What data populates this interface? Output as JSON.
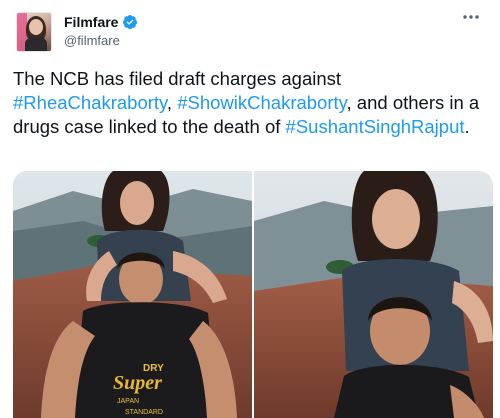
{
  "author": {
    "name": "Filmfare",
    "handle": "@filmfare",
    "verified": true,
    "avatar_icon": "filmfare-avatar"
  },
  "menu_icon": "more-dots-icon",
  "tweet": {
    "text_parts": [
      {
        "type": "text",
        "value": "The NCB has filed draft charges against "
      },
      {
        "type": "hashtag",
        "value": "#RheaChakraborty"
      },
      {
        "type": "text",
        "value": ", "
      },
      {
        "type": "hashtag",
        "value": "#ShowikChakraborty"
      },
      {
        "type": "text",
        "value": ", and others in a drugs case linked to the death of "
      },
      {
        "type": "hashtag",
        "value": "#SushantSinghRajput"
      },
      {
        "type": "text",
        "value": "."
      }
    ]
  },
  "media": {
    "photos": [
      {
        "icon": "couple-photo-left",
        "shirt_text": "DRY",
        "shirt_logo": "Super",
        "shirt_sub": "JAPAN",
        "shirt_bottom": "STANDARD"
      },
      {
        "icon": "couple-photo-right"
      }
    ]
  },
  "colors": {
    "link": "#1d9bf0",
    "verified": "#1d9bf0",
    "text": "#0f1419",
    "secondary": "#536471"
  }
}
